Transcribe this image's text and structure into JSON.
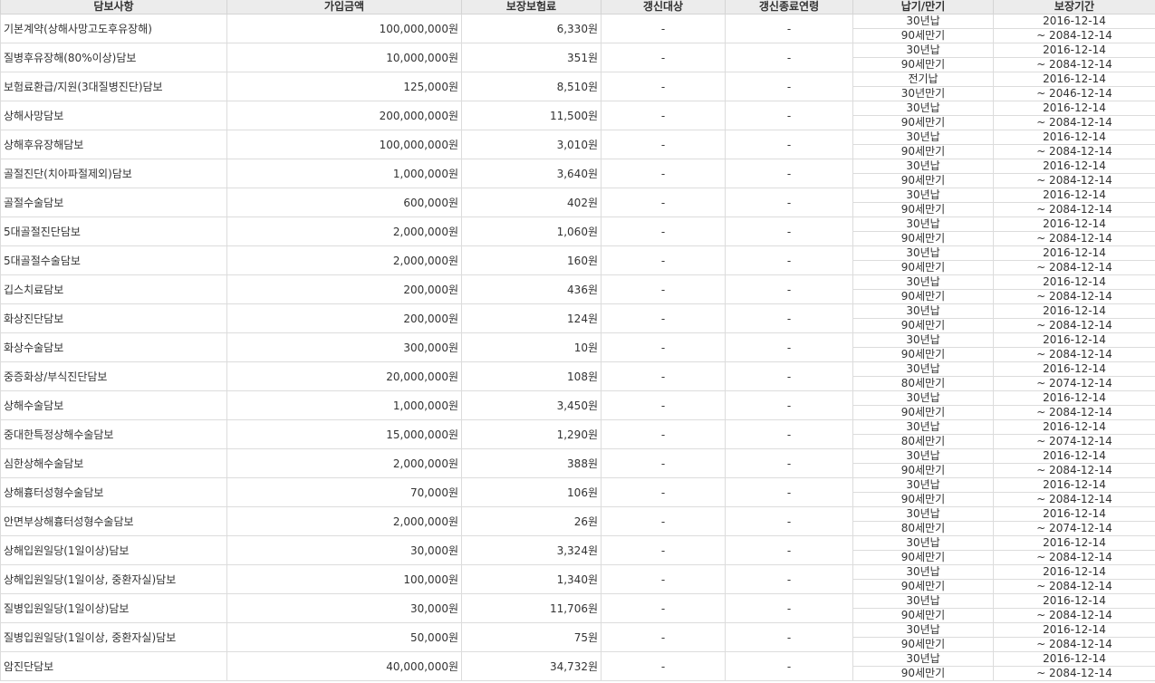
{
  "headers": [
    "담보사항",
    "가입금액",
    "보장보험료",
    "갱신대상",
    "갱신종료연령",
    "납기/만기",
    "보장기간"
  ],
  "rows": [
    {
      "name": "기본계약(상해사망고도후유장해)",
      "amount": "100,000,000원",
      "premium": "6,330원",
      "renewal": "-",
      "renewal_end": "-",
      "pay": "30년납",
      "maturity": "90세만기",
      "start": "2016-12-14",
      "end": "~ 2084-12-14"
    },
    {
      "name": "질병후유장해(80%이상)담보",
      "amount": "10,000,000원",
      "premium": "351원",
      "renewal": "-",
      "renewal_end": "-",
      "pay": "30년납",
      "maturity": "90세만기",
      "start": "2016-12-14",
      "end": "~ 2084-12-14"
    },
    {
      "name": "보험료환급/지원(3대질병진단)담보",
      "amount": "125,000원",
      "premium": "8,510원",
      "renewal": "-",
      "renewal_end": "-",
      "pay": "전기납",
      "maturity": "30년만기",
      "start": "2016-12-14",
      "end": "~ 2046-12-14"
    },
    {
      "name": "상해사망담보",
      "amount": "200,000,000원",
      "premium": "11,500원",
      "renewal": "-",
      "renewal_end": "-",
      "pay": "30년납",
      "maturity": "90세만기",
      "start": "2016-12-14",
      "end": "~ 2084-12-14"
    },
    {
      "name": "상해후유장해담보",
      "amount": "100,000,000원",
      "premium": "3,010원",
      "renewal": "-",
      "renewal_end": "-",
      "pay": "30년납",
      "maturity": "90세만기",
      "start": "2016-12-14",
      "end": "~ 2084-12-14"
    },
    {
      "name": "골절진단(치아파절제외)담보",
      "amount": "1,000,000원",
      "premium": "3,640원",
      "renewal": "-",
      "renewal_end": "-",
      "pay": "30년납",
      "maturity": "90세만기",
      "start": "2016-12-14",
      "end": "~ 2084-12-14"
    },
    {
      "name": "골절수술담보",
      "amount": "600,000원",
      "premium": "402원",
      "renewal": "-",
      "renewal_end": "-",
      "pay": "30년납",
      "maturity": "90세만기",
      "start": "2016-12-14",
      "end": "~ 2084-12-14"
    },
    {
      "name": "5대골절진단담보",
      "amount": "2,000,000원",
      "premium": "1,060원",
      "renewal": "-",
      "renewal_end": "-",
      "pay": "30년납",
      "maturity": "90세만기",
      "start": "2016-12-14",
      "end": "~ 2084-12-14"
    },
    {
      "name": "5대골절수술담보",
      "amount": "2,000,000원",
      "premium": "160원",
      "renewal": "-",
      "renewal_end": "-",
      "pay": "30년납",
      "maturity": "90세만기",
      "start": "2016-12-14",
      "end": "~ 2084-12-14"
    },
    {
      "name": "깁스치료담보",
      "amount": "200,000원",
      "premium": "436원",
      "renewal": "-",
      "renewal_end": "-",
      "pay": "30년납",
      "maturity": "90세만기",
      "start": "2016-12-14",
      "end": "~ 2084-12-14"
    },
    {
      "name": "화상진단담보",
      "amount": "200,000원",
      "premium": "124원",
      "renewal": "-",
      "renewal_end": "-",
      "pay": "30년납",
      "maturity": "90세만기",
      "start": "2016-12-14",
      "end": "~ 2084-12-14"
    },
    {
      "name": "화상수술담보",
      "amount": "300,000원",
      "premium": "10원",
      "renewal": "-",
      "renewal_end": "-",
      "pay": "30년납",
      "maturity": "90세만기",
      "start": "2016-12-14",
      "end": "~ 2084-12-14"
    },
    {
      "name": "중증화상/부식진단담보",
      "amount": "20,000,000원",
      "premium": "108원",
      "renewal": "-",
      "renewal_end": "-",
      "pay": "30년납",
      "maturity": "80세만기",
      "start": "2016-12-14",
      "end": "~ 2074-12-14"
    },
    {
      "name": "상해수술담보",
      "amount": "1,000,000원",
      "premium": "3,450원",
      "renewal": "-",
      "renewal_end": "-",
      "pay": "30년납",
      "maturity": "90세만기",
      "start": "2016-12-14",
      "end": "~ 2084-12-14"
    },
    {
      "name": "중대한특정상해수술담보",
      "amount": "15,000,000원",
      "premium": "1,290원",
      "renewal": "-",
      "renewal_end": "-",
      "pay": "30년납",
      "maturity": "80세만기",
      "start": "2016-12-14",
      "end": "~ 2074-12-14"
    },
    {
      "name": "심한상해수술담보",
      "amount": "2,000,000원",
      "premium": "388원",
      "renewal": "-",
      "renewal_end": "-",
      "pay": "30년납",
      "maturity": "90세만기",
      "start": "2016-12-14",
      "end": "~ 2084-12-14"
    },
    {
      "name": "상해흉터성형수술담보",
      "amount": "70,000원",
      "premium": "106원",
      "renewal": "-",
      "renewal_end": "-",
      "pay": "30년납",
      "maturity": "90세만기",
      "start": "2016-12-14",
      "end": "~ 2084-12-14"
    },
    {
      "name": "안면부상해흉터성형수술담보",
      "amount": "2,000,000원",
      "premium": "26원",
      "renewal": "-",
      "renewal_end": "-",
      "pay": "30년납",
      "maturity": "80세만기",
      "start": "2016-12-14",
      "end": "~ 2074-12-14"
    },
    {
      "name": "상해입원일당(1일이상)담보",
      "amount": "30,000원",
      "premium": "3,324원",
      "renewal": "-",
      "renewal_end": "-",
      "pay": "30년납",
      "maturity": "90세만기",
      "start": "2016-12-14",
      "end": "~ 2084-12-14"
    },
    {
      "name": "상해입원일당(1일이상, 중환자실)담보",
      "amount": "100,000원",
      "premium": "1,340원",
      "renewal": "-",
      "renewal_end": "-",
      "pay": "30년납",
      "maturity": "90세만기",
      "start": "2016-12-14",
      "end": "~ 2084-12-14"
    },
    {
      "name": "질병입원일당(1일이상)담보",
      "amount": "30,000원",
      "premium": "11,706원",
      "renewal": "-",
      "renewal_end": "-",
      "pay": "30년납",
      "maturity": "90세만기",
      "start": "2016-12-14",
      "end": "~ 2084-12-14"
    },
    {
      "name": "질병입원일당(1일이상, 중환자실)담보",
      "amount": "50,000원",
      "premium": "75원",
      "renewal": "-",
      "renewal_end": "-",
      "pay": "30년납",
      "maturity": "90세만기",
      "start": "2016-12-14",
      "end": "~ 2084-12-14"
    },
    {
      "name": "암진단담보",
      "amount": "40,000,000원",
      "premium": "34,732원",
      "renewal": "-",
      "renewal_end": "-",
      "pay": "30년납",
      "maturity": "90세만기",
      "start": "2016-12-14",
      "end": "~ 2084-12-14"
    }
  ]
}
